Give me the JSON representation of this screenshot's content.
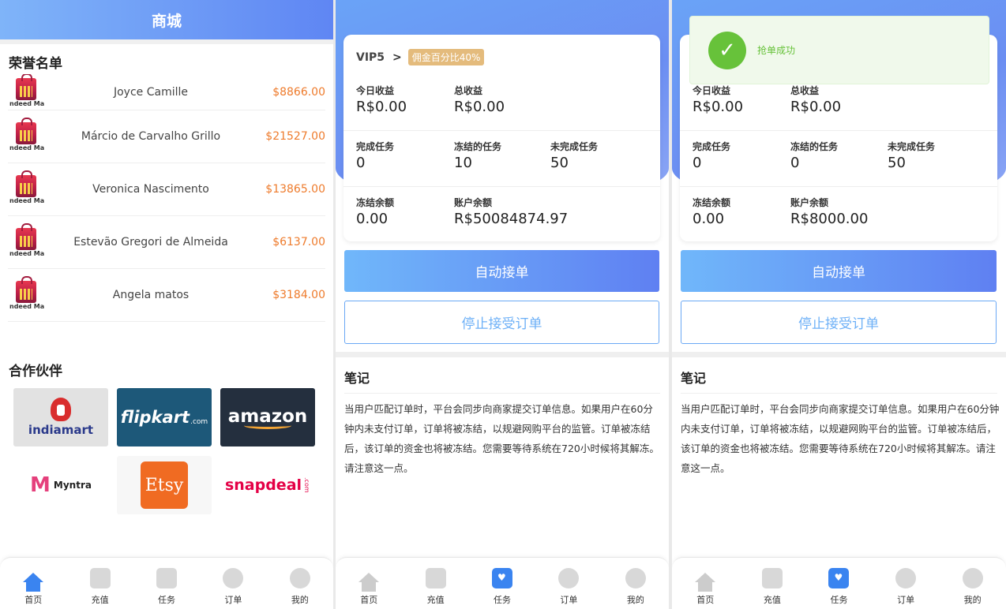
{
  "home": {
    "header_title": "商城",
    "honor_title": "荣誉名单",
    "honor_logo_text": "ndeed Ma",
    "honor_list": [
      {
        "name": "Joyce Camille",
        "amount": "$8866.00"
      },
      {
        "name": "Márcio de Carvalho Grillo",
        "amount": "$21527.00"
      },
      {
        "name": "Veronica Nascimento",
        "amount": "$13865.00"
      },
      {
        "name": "Estevão Gregori de Almeida",
        "amount": "$6137.00"
      },
      {
        "name": "Angela matos",
        "amount": "$3184.00"
      }
    ],
    "partner_title": "合作伙伴",
    "partners": {
      "indiamart": "indiamart",
      "flipkart": "flipkart",
      "flipkart_com": ".com",
      "amazon": "amazon",
      "myntra": "Myntra",
      "myntra_mark": "M",
      "etsy": "Etsy",
      "snapdeal": "snapdeal",
      "snapdeal_com": ".com"
    }
  },
  "tabs": [
    "首页",
    "充值",
    "任务",
    "订单",
    "我的"
  ],
  "task_before": {
    "vip": "VIP5",
    "vip_chevron": ">",
    "commission": "佣金百分比40%",
    "today_label": "今日收益",
    "today_value": "R$0.00",
    "total_label": "总收益",
    "total_value": "R$0.00",
    "done_label": "完成任务",
    "done_value": "0",
    "frozen_tasks_label": "冻结的任务",
    "frozen_tasks_value": "10",
    "pending_label": "未完成任务",
    "pending_value": "50",
    "frozen_amount_label": "冻结余额",
    "frozen_amount_value": "0.00",
    "balance_label": "账户余额",
    "balance_value": "R$50084874.97",
    "auto_button": "自动接单",
    "stop_button": "停止接受订单",
    "note_title": "笔记",
    "note_text": "当用户匹配订单时，平台会同步向商家提交订单信息。如果用户在60分钟内未支付订单，订单将被冻结，以规避网购平台的监管。订单被冻结后，该订单的资金也将被冻结。您需要等待系统在720小时候将其解冻。请注意这一点。"
  },
  "task_after": {
    "toast": "抢单成功",
    "today_label": "今日收益",
    "today_value": "R$0.00",
    "total_label": "总收益",
    "total_value": "R$0.00",
    "done_label": "完成任务",
    "done_value": "0",
    "frozen_tasks_label": "冻结的任务",
    "frozen_tasks_value": "0",
    "pending_label": "未完成任务",
    "pending_value": "50",
    "frozen_amount_label": "冻结余额",
    "frozen_amount_value": "0.00",
    "balance_label": "账户余额",
    "balance_value": "R$8000.00",
    "auto_button": "自动接单",
    "stop_button": "停止接受订单",
    "note_title": "笔记",
    "note_text": "当用户匹配订单时，平台会同步向商家提交订单信息。如果用户在60分钟内未支付订单，订单将被冻结，以规避网购平台的监管。订单被冻结后，该订单的资金也将被冻结。您需要等待系统在720小时候将其解冻。请注意这一点。"
  },
  "colors": {
    "accent": "#5f86f3",
    "amount": "#ee7b2c",
    "success": "#67c23a",
    "badge": "#e4bb7c"
  }
}
